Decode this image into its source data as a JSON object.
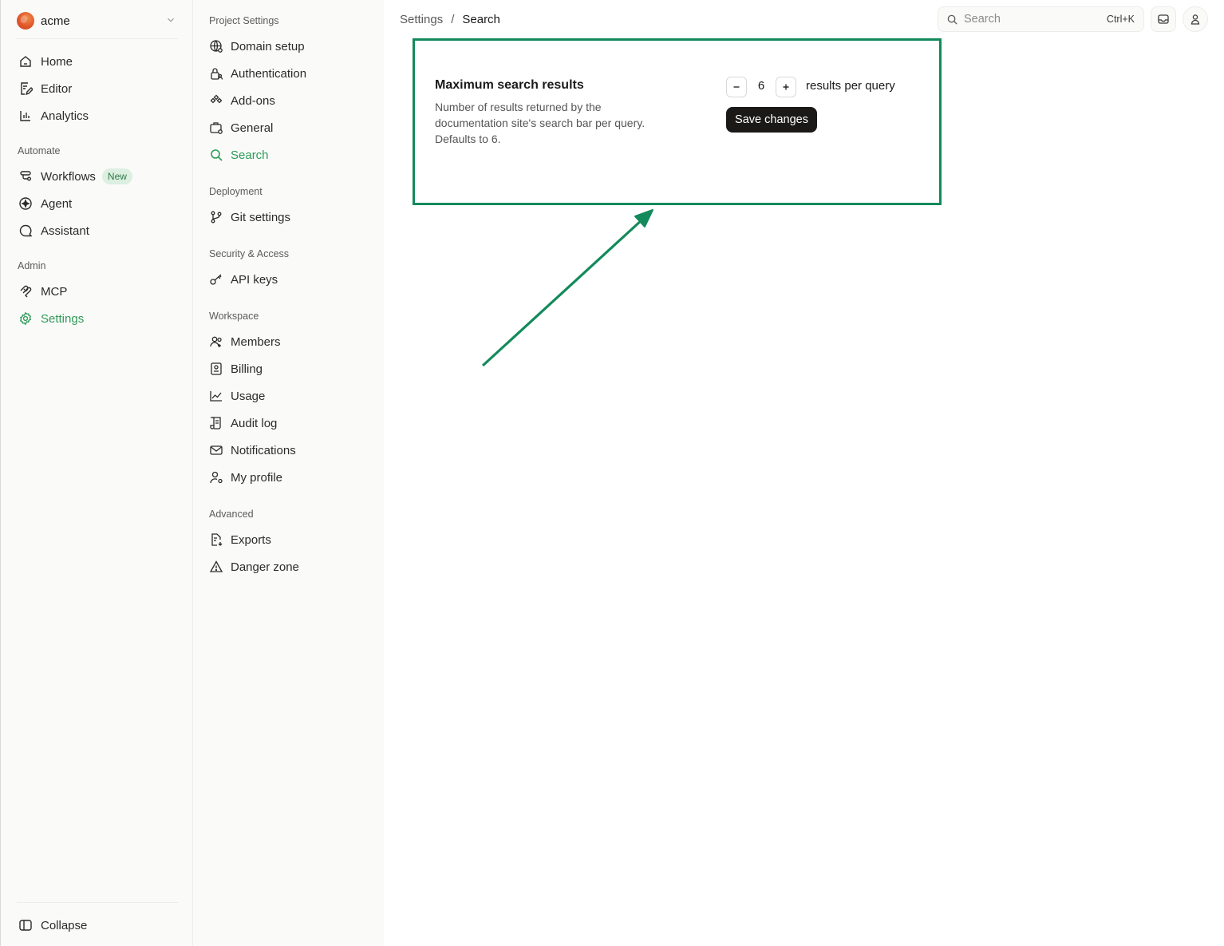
{
  "org": {
    "name": "acme"
  },
  "sidebar": {
    "items": [
      {
        "label": "Home"
      },
      {
        "label": "Editor"
      },
      {
        "label": "Analytics"
      }
    ],
    "automate": {
      "title": "Automate",
      "items": [
        {
          "label": "Workflows",
          "badge": "New"
        },
        {
          "label": "Agent"
        },
        {
          "label": "Assistant"
        }
      ]
    },
    "admin": {
      "title": "Admin",
      "items": [
        {
          "label": "MCP"
        },
        {
          "label": "Settings"
        }
      ]
    },
    "collapse_label": "Collapse"
  },
  "settings_nav": {
    "project": {
      "title": "Project Settings",
      "items": [
        {
          "label": "Domain setup"
        },
        {
          "label": "Authentication"
        },
        {
          "label": "Add-ons"
        },
        {
          "label": "General"
        },
        {
          "label": "Search"
        }
      ]
    },
    "deployment": {
      "title": "Deployment",
      "items": [
        {
          "label": "Git settings"
        }
      ]
    },
    "security": {
      "title": "Security & Access",
      "items": [
        {
          "label": "API keys"
        }
      ]
    },
    "workspace": {
      "title": "Workspace",
      "items": [
        {
          "label": "Members"
        },
        {
          "label": "Billing"
        },
        {
          "label": "Usage"
        },
        {
          "label": "Audit log"
        },
        {
          "label": "Notifications"
        },
        {
          "label": "My profile"
        }
      ]
    },
    "advanced": {
      "title": "Advanced",
      "items": [
        {
          "label": "Exports"
        },
        {
          "label": "Danger zone"
        }
      ]
    }
  },
  "header": {
    "breadcrumb": {
      "parent": "Settings",
      "separator": "/",
      "current": "Search"
    },
    "search": {
      "placeholder": "Search",
      "shortcut": "Ctrl+K"
    }
  },
  "setting": {
    "title": "Maximum search results",
    "description": "Number of results returned by the documentation site's search bar per query. Defaults to 6.",
    "value": "6",
    "unit": "results per query",
    "save_label": "Save changes"
  },
  "colors": {
    "accent": "#2f9b57",
    "highlight": "#138a5c",
    "primary_button": "#1b1918"
  }
}
